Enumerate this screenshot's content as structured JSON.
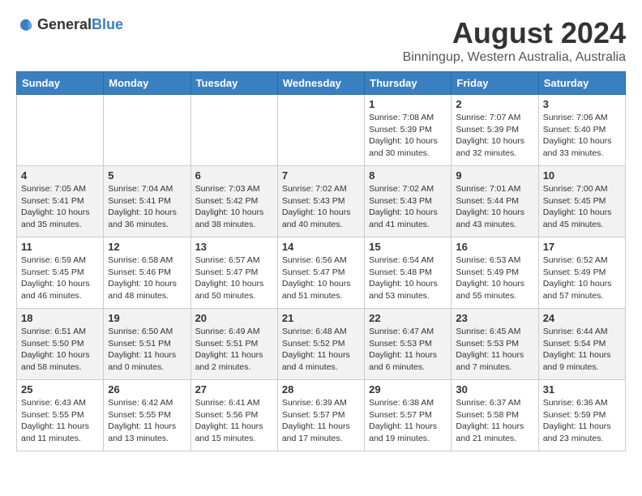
{
  "header": {
    "logo_general": "General",
    "logo_blue": "Blue",
    "title": "August 2024",
    "subtitle": "Binningup, Western Australia, Australia"
  },
  "weekdays": [
    "Sunday",
    "Monday",
    "Tuesday",
    "Wednesday",
    "Thursday",
    "Friday",
    "Saturday"
  ],
  "weeks": [
    [
      {
        "day": "",
        "empty": true
      },
      {
        "day": "",
        "empty": true
      },
      {
        "day": "",
        "empty": true
      },
      {
        "day": "",
        "empty": true
      },
      {
        "day": "1",
        "sunrise": "7:08 AM",
        "sunset": "5:39 PM",
        "daylight": "10 hours and 30 minutes."
      },
      {
        "day": "2",
        "sunrise": "7:07 AM",
        "sunset": "5:39 PM",
        "daylight": "10 hours and 32 minutes."
      },
      {
        "day": "3",
        "sunrise": "7:06 AM",
        "sunset": "5:40 PM",
        "daylight": "10 hours and 33 minutes."
      }
    ],
    [
      {
        "day": "4",
        "sunrise": "7:05 AM",
        "sunset": "5:41 PM",
        "daylight": "10 hours and 35 minutes."
      },
      {
        "day": "5",
        "sunrise": "7:04 AM",
        "sunset": "5:41 PM",
        "daylight": "10 hours and 36 minutes."
      },
      {
        "day": "6",
        "sunrise": "7:03 AM",
        "sunset": "5:42 PM",
        "daylight": "10 hours and 38 minutes."
      },
      {
        "day": "7",
        "sunrise": "7:02 AM",
        "sunset": "5:43 PM",
        "daylight": "10 hours and 40 minutes."
      },
      {
        "day": "8",
        "sunrise": "7:02 AM",
        "sunset": "5:43 PM",
        "daylight": "10 hours and 41 minutes."
      },
      {
        "day": "9",
        "sunrise": "7:01 AM",
        "sunset": "5:44 PM",
        "daylight": "10 hours and 43 minutes."
      },
      {
        "day": "10",
        "sunrise": "7:00 AM",
        "sunset": "5:45 PM",
        "daylight": "10 hours and 45 minutes."
      }
    ],
    [
      {
        "day": "11",
        "sunrise": "6:59 AM",
        "sunset": "5:45 PM",
        "daylight": "10 hours and 46 minutes."
      },
      {
        "day": "12",
        "sunrise": "6:58 AM",
        "sunset": "5:46 PM",
        "daylight": "10 hours and 48 minutes."
      },
      {
        "day": "13",
        "sunrise": "6:57 AM",
        "sunset": "5:47 PM",
        "daylight": "10 hours and 50 minutes."
      },
      {
        "day": "14",
        "sunrise": "6:56 AM",
        "sunset": "5:47 PM",
        "daylight": "10 hours and 51 minutes."
      },
      {
        "day": "15",
        "sunrise": "6:54 AM",
        "sunset": "5:48 PM",
        "daylight": "10 hours and 53 minutes."
      },
      {
        "day": "16",
        "sunrise": "6:53 AM",
        "sunset": "5:49 PM",
        "daylight": "10 hours and 55 minutes."
      },
      {
        "day": "17",
        "sunrise": "6:52 AM",
        "sunset": "5:49 PM",
        "daylight": "10 hours and 57 minutes."
      }
    ],
    [
      {
        "day": "18",
        "sunrise": "6:51 AM",
        "sunset": "5:50 PM",
        "daylight": "10 hours and 58 minutes."
      },
      {
        "day": "19",
        "sunrise": "6:50 AM",
        "sunset": "5:51 PM",
        "daylight": "11 hours and 0 minutes."
      },
      {
        "day": "20",
        "sunrise": "6:49 AM",
        "sunset": "5:51 PM",
        "daylight": "11 hours and 2 minutes."
      },
      {
        "day": "21",
        "sunrise": "6:48 AM",
        "sunset": "5:52 PM",
        "daylight": "11 hours and 4 minutes."
      },
      {
        "day": "22",
        "sunrise": "6:47 AM",
        "sunset": "5:53 PM",
        "daylight": "11 hours and 6 minutes."
      },
      {
        "day": "23",
        "sunrise": "6:45 AM",
        "sunset": "5:53 PM",
        "daylight": "11 hours and 7 minutes."
      },
      {
        "day": "24",
        "sunrise": "6:44 AM",
        "sunset": "5:54 PM",
        "daylight": "11 hours and 9 minutes."
      }
    ],
    [
      {
        "day": "25",
        "sunrise": "6:43 AM",
        "sunset": "5:55 PM",
        "daylight": "11 hours and 11 minutes."
      },
      {
        "day": "26",
        "sunrise": "6:42 AM",
        "sunset": "5:55 PM",
        "daylight": "11 hours and 13 minutes."
      },
      {
        "day": "27",
        "sunrise": "6:41 AM",
        "sunset": "5:56 PM",
        "daylight": "11 hours and 15 minutes."
      },
      {
        "day": "28",
        "sunrise": "6:39 AM",
        "sunset": "5:57 PM",
        "daylight": "11 hours and 17 minutes."
      },
      {
        "day": "29",
        "sunrise": "6:38 AM",
        "sunset": "5:57 PM",
        "daylight": "11 hours and 19 minutes."
      },
      {
        "day": "30",
        "sunrise": "6:37 AM",
        "sunset": "5:58 PM",
        "daylight": "11 hours and 21 minutes."
      },
      {
        "day": "31",
        "sunrise": "6:36 AM",
        "sunset": "5:59 PM",
        "daylight": "11 hours and 23 minutes."
      }
    ]
  ],
  "labels": {
    "sunrise": "Sunrise:",
    "sunset": "Sunset:",
    "daylight": "Daylight:"
  }
}
